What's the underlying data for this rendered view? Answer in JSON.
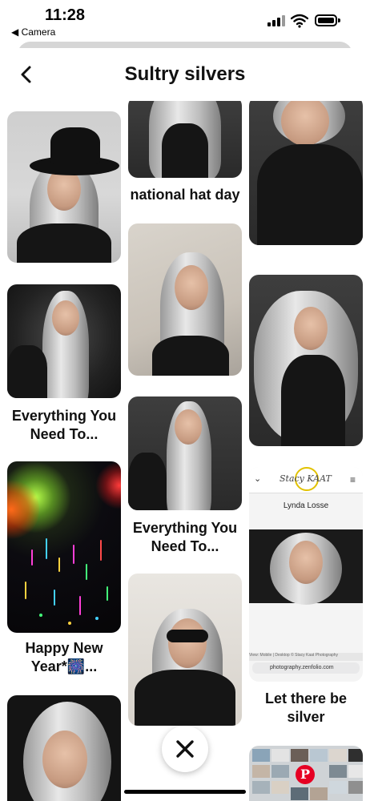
{
  "status_bar": {
    "time": "11:28",
    "back_app": "◀ Camera"
  },
  "header": {
    "title": "Sultry silvers",
    "back_icon": "chevron-left-icon"
  },
  "pins": {
    "col2_pin1_title": "national hat day",
    "col1_pin2_title_line1": "Everything You",
    "col1_pin2_title_line2": "Need To...",
    "col2_pin3_title_line1": "Everything You",
    "col2_pin3_title_line2": "Need To...",
    "col1_pin3_title_line1": "Happy New",
    "col1_pin3_title_line2": "Year*🎆...",
    "col3_pin3_title_line1": "Let there be",
    "col3_pin3_title_line2": "silver"
  },
  "stacy_card": {
    "logo": "Stacy KAAT",
    "name": "Lynda Losse",
    "url": "photography.zenfolio.com",
    "footer_text": "View: Mobile | Desktop   © Stacy Kaat Photography"
  },
  "close_button": {
    "icon": "close-icon"
  },
  "colors": {
    "background": "#ffffff",
    "text": "#111111",
    "pinterest_red": "#e60023"
  }
}
